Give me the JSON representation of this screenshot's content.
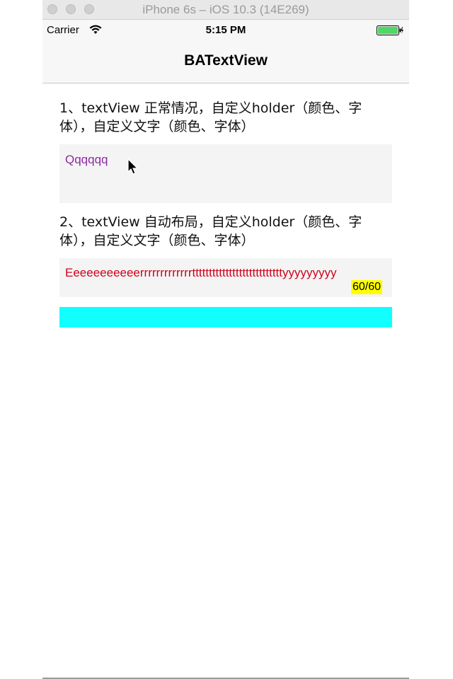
{
  "simulator": {
    "title": "iPhone 6s – iOS 10.3 (14E269)"
  },
  "status_bar": {
    "carrier": "Carrier",
    "time": "5:15 PM",
    "wifi_icon": "wifi-icon",
    "battery_icon": "battery-icon",
    "battery_color": "#4cd964"
  },
  "nav": {
    "title": "BATextView"
  },
  "section1": {
    "label": "1、textView 正常情况，自定义holder（颜色、字体），自定义文字（颜色、字体）",
    "text": "Qqqqqq",
    "text_color": "#8e2aa2"
  },
  "section2": {
    "label": "2、textView 自动布局，自定义holder（颜色、字体），自定义文字（颜色、字体）",
    "text": "Eeeeeeeeeeerrrrrrrrrrrrrtttttttttttttttttttttttttttyyyyyyyyy",
    "text_color": "#d0021b",
    "counter": "60/60",
    "counter_bg": "#ffff00"
  },
  "cyan_bar_color": "#11ffff",
  "cursor_icon": "mouse-pointer-icon"
}
